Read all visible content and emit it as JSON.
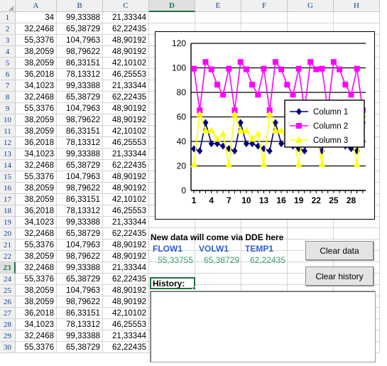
{
  "spreadsheet": {
    "column_headers": [
      "A",
      "B",
      "C",
      "D",
      "E",
      "F",
      "G",
      "H"
    ],
    "selected_column": "D",
    "selected_row": 23,
    "selected_cell": "D23",
    "row_numbers": [
      1,
      2,
      3,
      4,
      5,
      6,
      7,
      8,
      9,
      10,
      11,
      12,
      13,
      14,
      15,
      16,
      17,
      18,
      19,
      20,
      21,
      22,
      23,
      24,
      25,
      26,
      27,
      28,
      29,
      30
    ],
    "rows": [
      {
        "n": 1,
        "A": "34",
        "B": "99,33388",
        "C": "21,33344"
      },
      {
        "n": 2,
        "A": "32,2468",
        "B": "65,38729",
        "C": "62,22435"
      },
      {
        "n": 3,
        "A": "55,3376",
        "B": "104,7963",
        "C": "48,90192"
      },
      {
        "n": 4,
        "A": "38,2059",
        "B": "98,79622",
        "C": "48,90192"
      },
      {
        "n": 5,
        "A": "38,2059",
        "B": "86,33151",
        "C": "42,10102"
      },
      {
        "n": 6,
        "A": "36,2018",
        "B": "78,13312",
        "C": "46,25553"
      },
      {
        "n": 7,
        "A": "34,1023",
        "B": "99,33388",
        "C": "21,33344"
      },
      {
        "n": 8,
        "A": "32,2468",
        "B": "65,38729",
        "C": "62,22435"
      },
      {
        "n": 9,
        "A": "55,3376",
        "B": "104,7963",
        "C": "48,90192"
      },
      {
        "n": 10,
        "A": "38,2059",
        "B": "98,79622",
        "C": "48,90192"
      },
      {
        "n": 11,
        "A": "38,2059",
        "B": "86,33151",
        "C": "42,10102"
      },
      {
        "n": 12,
        "A": "36,2018",
        "B": "78,13312",
        "C": "46,25553"
      },
      {
        "n": 13,
        "A": "34,1023",
        "B": "99,33388",
        "C": "21,33344"
      },
      {
        "n": 14,
        "A": "32,2468",
        "B": "65,38729",
        "C": "62,22435"
      },
      {
        "n": 15,
        "A": "55,3376",
        "B": "104,7963",
        "C": "48,90192"
      },
      {
        "n": 16,
        "A": "38,2059",
        "B": "98,79622",
        "C": "48,90192"
      },
      {
        "n": 17,
        "A": "38,2059",
        "B": "86,33151",
        "C": "42,10102"
      },
      {
        "n": 18,
        "A": "36,2018",
        "B": "78,13312",
        "C": "46,25553"
      },
      {
        "n": 19,
        "A": "34,1023",
        "B": "99,33388",
        "C": "21,33344"
      },
      {
        "n": 20,
        "A": "32,2468",
        "B": "65,38729",
        "C": "62,22435"
      },
      {
        "n": 21,
        "A": "55,3376",
        "B": "104,7963",
        "C": "48,90192"
      },
      {
        "n": 22,
        "A": "38,2059",
        "B": "98,79622",
        "C": "48,90192"
      },
      {
        "n": 23,
        "A": "32,2468",
        "B": "99,33388",
        "C": "21,33344"
      },
      {
        "n": 24,
        "A": "55,3376",
        "B": "65,38729",
        "C": "62,22435"
      },
      {
        "n": 25,
        "A": "38,2059",
        "B": "104,7963",
        "C": "48,90192"
      },
      {
        "n": 26,
        "A": "38,2059",
        "B": "98,79622",
        "C": "48,90192"
      },
      {
        "n": 27,
        "A": "36,2018",
        "B": "86,33151",
        "C": "42,10102"
      },
      {
        "n": 28,
        "A": "34,1023",
        "B": "78,13312",
        "C": "46,25553"
      },
      {
        "n": 29,
        "A": "32,2468",
        "B": "99,33388",
        "C": "21,33344"
      },
      {
        "n": 30,
        "A": "55,3376",
        "B": "65,38729",
        "C": "62,22435"
      }
    ]
  },
  "dde": {
    "title": "New data will come via DDE here",
    "headers": [
      "FLOW1",
      "VOLW1",
      "TEMP1"
    ],
    "values": [
      "55,33755",
      "65,38729",
      "62,22435"
    ],
    "header_color": "#2f5fd0",
    "value_color": "#3aa06a",
    "history_label": "History:",
    "history_content": ""
  },
  "buttons": {
    "clear_data": "Clear data",
    "clear_history": "Clear history"
  },
  "chart_data": {
    "type": "line",
    "title": "",
    "xlabel": "",
    "ylabel": "",
    "ylim": [
      0,
      120
    ],
    "yticks": [
      0,
      20,
      40,
      60,
      80,
      100,
      120
    ],
    "xticks": [
      1,
      4,
      7,
      10,
      13,
      16,
      19,
      22,
      25,
      28
    ],
    "grid": true,
    "legend_position": "middle-right",
    "x": [
      1,
      2,
      3,
      4,
      5,
      6,
      7,
      8,
      9,
      10,
      11,
      12,
      13,
      14,
      15,
      16,
      17,
      18,
      19,
      20,
      21,
      22,
      23,
      24,
      25,
      26,
      27,
      28,
      29,
      30
    ],
    "series": [
      {
        "name": "Column 1",
        "color": "#000080",
        "marker": "diamond",
        "values": [
          34,
          32.2468,
          55.3376,
          38.2059,
          38.2059,
          36.2018,
          34.1023,
          32.2468,
          55.3376,
          38.2059,
          38.2059,
          36.2018,
          34.1023,
          32.2468,
          55.3376,
          38.2059,
          38.2059,
          36.2018,
          34.1023,
          32.2468,
          55.3376,
          38.2059,
          32.2468,
          55.3376,
          38.2059,
          38.2059,
          36.2018,
          34.1023,
          32.2468,
          55.3376
        ]
      },
      {
        "name": "Column 2",
        "color": "#ff00ff",
        "marker": "square",
        "values": [
          99.33388,
          65.38729,
          104.7963,
          98.79622,
          86.33151,
          78.13312,
          99.33388,
          65.38729,
          104.7963,
          98.79622,
          86.33151,
          78.13312,
          99.33388,
          65.38729,
          104.7963,
          98.79622,
          86.33151,
          78.13312,
          99.33388,
          65.38729,
          104.7963,
          98.79622,
          99.33388,
          65.38729,
          104.7963,
          98.79622,
          86.33151,
          78.13312,
          99.33388,
          65.38729
        ]
      },
      {
        "name": "Column 3",
        "color": "#ffff00",
        "marker": "triangle",
        "values": [
          21.33344,
          62.22435,
          48.90192,
          48.90192,
          42.10102,
          46.25553,
          21.33344,
          62.22435,
          48.90192,
          48.90192,
          42.10102,
          46.25553,
          21.33344,
          62.22435,
          48.90192,
          48.90192,
          42.10102,
          46.25553,
          21.33344,
          62.22435,
          48.90192,
          48.90192,
          21.33344,
          62.22435,
          48.90192,
          48.90192,
          42.10102,
          46.25553,
          21.33344,
          62.22435
        ]
      }
    ]
  }
}
